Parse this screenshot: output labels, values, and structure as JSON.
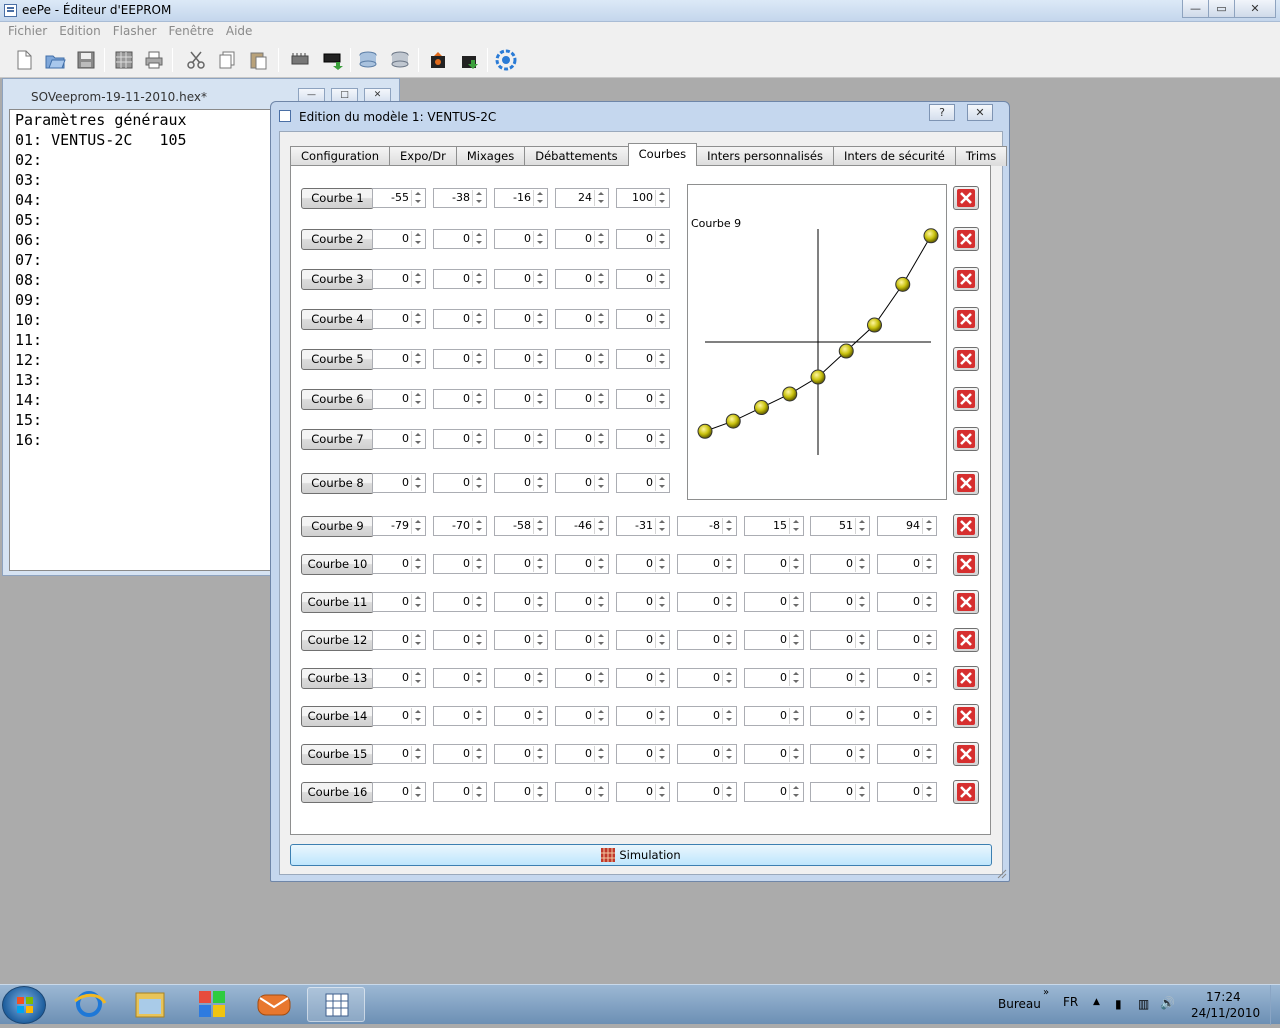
{
  "window": {
    "title": "eePe - Éditeur d'EEPROM"
  },
  "menu": [
    "Fichier",
    "Edition",
    "Flasher",
    "Fenêtre",
    "Aide"
  ],
  "toolbar": {
    "icons": [
      "new-icon",
      "open-icon",
      "save-icon",
      "preferences-icon",
      "print-icon",
      "cut-icon",
      "copy-icon",
      "paste-icon",
      "read-flash-icon",
      "write-flash-icon",
      "read-eeprom-icon",
      "write-eeprom-icon",
      "read-backup-icon",
      "write-backup-icon",
      "configure-icon"
    ]
  },
  "subwindow": {
    "title": "SOVeeprom-19-11-2010.hex*",
    "lines": [
      "Paramètres généraux",
      "01: VENTUS-2C   105",
      "02:",
      "03:",
      "04:",
      "05:",
      "06:",
      "07:",
      "08:",
      "09:",
      "10:",
      "11:",
      "12:",
      "13:",
      "14:",
      "15:",
      "16:"
    ]
  },
  "dialog": {
    "title": "Edition du modèle 1: VENTUS-2C",
    "help": "?",
    "close": "✕",
    "tabs": [
      "Configuration",
      "Expo/Dr",
      "Mixages",
      "Débattements",
      "Courbes",
      "Inters personnalisés",
      "Inters de sécurité",
      "Trims"
    ],
    "active_tab": "Courbes",
    "graph_label": "Courbe 9",
    "curves5": [
      {
        "label": "Courbe 1",
        "values": [
          "-55",
          "-38",
          "-16",
          "24",
          "100"
        ]
      },
      {
        "label": "Courbe 2",
        "values": [
          "0",
          "0",
          "0",
          "0",
          "0"
        ]
      },
      {
        "label": "Courbe 3",
        "values": [
          "0",
          "0",
          "0",
          "0",
          "0"
        ]
      },
      {
        "label": "Courbe 4",
        "values": [
          "0",
          "0",
          "0",
          "0",
          "0"
        ]
      },
      {
        "label": "Courbe 5",
        "values": [
          "0",
          "0",
          "0",
          "0",
          "0"
        ]
      },
      {
        "label": "Courbe 6",
        "values": [
          "0",
          "0",
          "0",
          "0",
          "0"
        ]
      },
      {
        "label": "Courbe 7",
        "values": [
          "0",
          "0",
          "0",
          "0",
          "0"
        ]
      },
      {
        "label": "Courbe 8",
        "values": [
          "0",
          "0",
          "0",
          "0",
          "0"
        ]
      }
    ],
    "curves9": [
      {
        "label": "Courbe 9",
        "values": [
          "-79",
          "-70",
          "-58",
          "-46",
          "-31",
          "-8",
          "15",
          "51",
          "94"
        ]
      },
      {
        "label": "Courbe 10",
        "values": [
          "0",
          "0",
          "0",
          "0",
          "0",
          "0",
          "0",
          "0",
          "0"
        ]
      },
      {
        "label": "Courbe 11",
        "values": [
          "0",
          "0",
          "0",
          "0",
          "0",
          "0",
          "0",
          "0",
          "0"
        ]
      },
      {
        "label": "Courbe 12",
        "values": [
          "0",
          "0",
          "0",
          "0",
          "0",
          "0",
          "0",
          "0",
          "0"
        ]
      },
      {
        "label": "Courbe 13",
        "values": [
          "0",
          "0",
          "0",
          "0",
          "0",
          "0",
          "0",
          "0",
          "0"
        ]
      },
      {
        "label": "Courbe 14",
        "values": [
          "0",
          "0",
          "0",
          "0",
          "0",
          "0",
          "0",
          "0",
          "0"
        ]
      },
      {
        "label": "Courbe 15",
        "values": [
          "0",
          "0",
          "0",
          "0",
          "0",
          "0",
          "0",
          "0",
          "0"
        ]
      },
      {
        "label": "Courbe 16",
        "values": [
          "0",
          "0",
          "0",
          "0",
          "0",
          "0",
          "0",
          "0",
          "0"
        ]
      }
    ],
    "graph_points": [
      -79,
      -70,
      -58,
      -46,
      -31,
      -8,
      15,
      51,
      94
    ],
    "simulation": "Simulation"
  },
  "taskbar": {
    "tray_label": "Bureau",
    "chevron": "»",
    "lang": "FR",
    "time": "17:24",
    "date": "24/11/2010"
  }
}
